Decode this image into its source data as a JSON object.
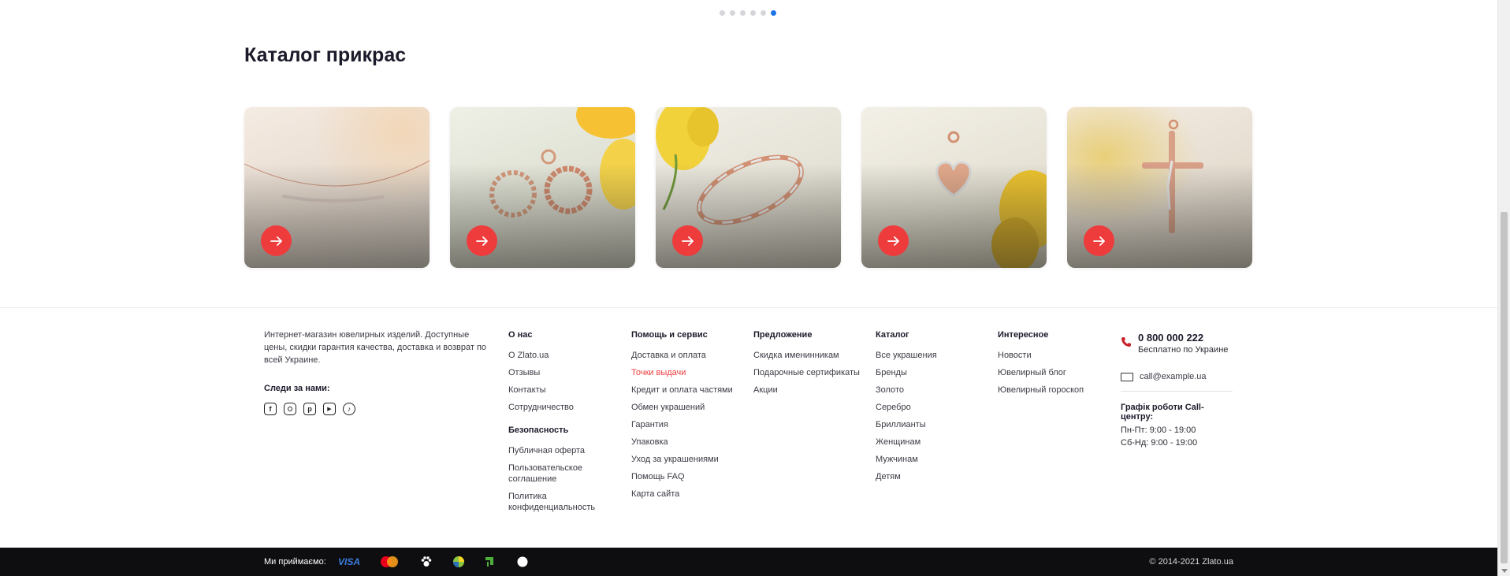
{
  "carousel": {
    "dots": 6,
    "active_index": 5
  },
  "catalog": {
    "title": "Каталог прикрас",
    "cards": [
      {
        "name": "necklace"
      },
      {
        "name": "earrings"
      },
      {
        "name": "bracelet"
      },
      {
        "name": "pendant"
      },
      {
        "name": "cross"
      }
    ]
  },
  "footer": {
    "about": "Интернет-магазин ювелирных изделий. Доступные цены, скидки гарантия качества, доставка и возврат по всей Украине.",
    "follow": "Следи за нами:",
    "social_icons": [
      "facebook-icon",
      "instagram-icon",
      "pinterest-icon",
      "youtube-icon",
      "tiktok-icon"
    ],
    "columns": {
      "about_us": {
        "title": "О нас",
        "links": [
          "О Zlato.ua",
          "Отзывы",
          "Контакты",
          "Сотрудничество"
        ]
      },
      "security": {
        "title": "Безопасность",
        "links": [
          "Публичная оферта",
          "Пользовательское соглашение",
          "Политика конфиденциальность"
        ]
      },
      "help": {
        "title": "Помощь и сервис",
        "links": [
          "Доставка и оплата",
          "Точки выдачи",
          "Кредит и оплата частями",
          "Обмен украшений",
          "Гарантия",
          "Упаковка",
          "Уход за украшениями",
          "Помощь FAQ",
          "Карта сайта"
        ]
      },
      "offers": {
        "title": "Предложение",
        "links": [
          "Скидка именинникам",
          "Подарочные сертификаты",
          "Акции"
        ]
      },
      "catalog": {
        "title": "Каталог",
        "links": [
          "Все украшения",
          "Бренды",
          "Золото",
          "Серебро",
          "Бриллианты",
          "Женщинам",
          "Мужчинам",
          "Детям"
        ]
      },
      "interesting": {
        "title": "Интересное",
        "links": [
          "Новости",
          "Ювелирный блог",
          "Ювелирный гороскоп"
        ]
      }
    },
    "contact": {
      "phone": "0 800 000 222",
      "phone_note": "Бесплатно по Украине",
      "email": "call@example.ua",
      "schedule_title": "Графік роботи Call-центру:",
      "schedule": [
        "Пн-Пт: 9:00 - 19:00",
        "Сб-Нд: 9:00 - 19:00"
      ]
    }
  },
  "bottom_bar": {
    "accept": "Ми приймаємо:",
    "visa": "VISA",
    "copyright": "© 2014-2021 Zlato.ua"
  },
  "colors": {
    "accent": "#ee3b3c",
    "dot_active": "#1e73e8",
    "bottom_bg": "#0e0e10"
  }
}
